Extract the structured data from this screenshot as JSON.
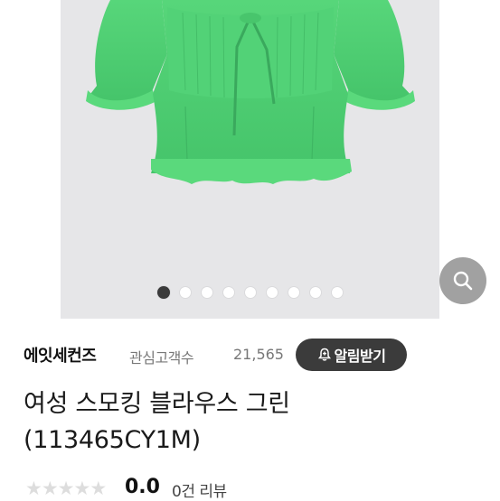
{
  "gallery": {
    "dot_count": 9,
    "active_index": 0,
    "zoom_icon": "search-icon"
  },
  "seller": {
    "brand": "에잇세컨즈",
    "fans_label": "관심고객수",
    "fans_count": "21,565",
    "alarm_icon": "bell-plus-icon",
    "alarm_label": "알림받기"
  },
  "product": {
    "title_line1": "여성 스모킹 블라우스 그린",
    "title_line2": "(113465CY1M)"
  },
  "rating": {
    "stars": 0,
    "max_stars": 5,
    "score": "0.0",
    "review_text": "0건 리뷰"
  },
  "colors": {
    "photo_bg": "#e6e6e8",
    "blouse_green": "#4fcf73",
    "button_dark": "#3b3b3b"
  }
}
